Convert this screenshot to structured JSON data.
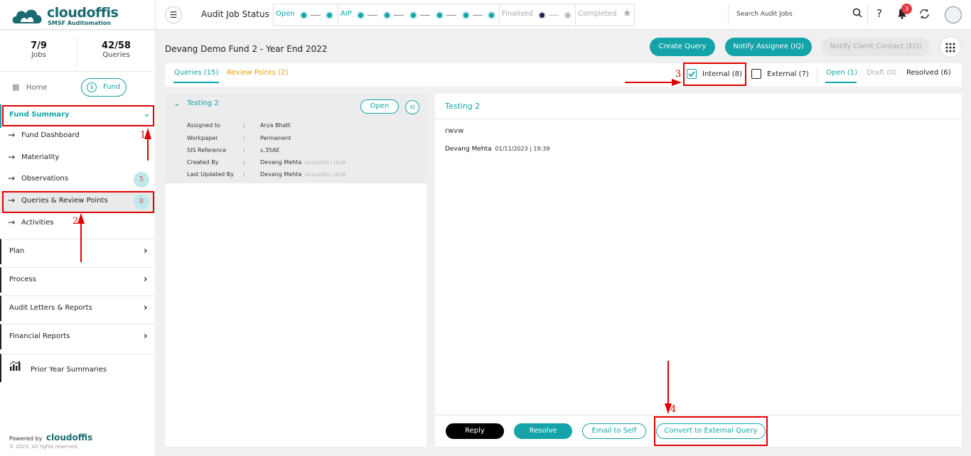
{
  "header": {
    "brand": "cloudoffis",
    "tagline": "SMSF Auditomation",
    "status_title": "Audit Job Status",
    "stages": [
      {
        "label": "Open",
        "dots": 2,
        "state": "active"
      },
      {
        "label": "AIP",
        "dots": 6,
        "state": "active"
      },
      {
        "label": "Finalised",
        "dots": 2,
        "state": "inactive"
      },
      {
        "label": "Completed",
        "dots": 0,
        "state": "inactive"
      }
    ],
    "search_placeholder": "Search Audit Jobs",
    "notification_count": "3",
    "help_label": "?"
  },
  "sidebar": {
    "stats": [
      {
        "value": "7/9",
        "label": "Jobs"
      },
      {
        "value": "42/58",
        "label": "Queries"
      }
    ],
    "home_label": "Home",
    "fund_label": "Fund",
    "fund_summary_label": "Fund Summary",
    "items": [
      {
        "label": "Fund Dashboard",
        "count": ""
      },
      {
        "label": "Materiality",
        "count": ""
      },
      {
        "label": "Observations",
        "count": "5"
      },
      {
        "label": "Queries & Review Points",
        "count": "8"
      },
      {
        "label": "Activities",
        "count": ""
      }
    ],
    "sections": [
      {
        "label": "Plan"
      },
      {
        "label": "Process"
      },
      {
        "label": "Audit Letters & Reports"
      },
      {
        "label": "Financial Reports"
      }
    ],
    "prior_year_label": "Prior Year Summaries",
    "powered_by": "Powered by",
    "footer_brand": "cloudoffis",
    "copyright": "© 2023. All rights reserved."
  },
  "main": {
    "title": "Devang Demo Fund 2 - Year End 2022",
    "actions": {
      "create_query": "Create Query",
      "notify_assignee": "Notify Assignee (IQ)",
      "notify_client": "Notify Client Contact (EQ)"
    },
    "tabs": {
      "queries": "Queries (15)",
      "review_points": "Review Points (2)"
    },
    "filters": {
      "internal": "Internal (8)",
      "external": "External (7)",
      "open": "Open (1)",
      "draft": "Draft (0)",
      "resolved": "Resolved (6)"
    },
    "query_card": {
      "title": "Testing 2",
      "status": "Open",
      "type": "IQ",
      "fields": [
        {
          "label": "Assigned to",
          "value": "Arya Bhatt",
          "ts": ""
        },
        {
          "label": "Workpaper",
          "value": "Permanent",
          "ts": ""
        },
        {
          "label": "SIS Reference",
          "value": "s.35AE",
          "ts": ""
        },
        {
          "label": "Created By",
          "value": "Devang Mehta",
          "ts": "01/11/2023 | 19:39"
        },
        {
          "label": "Last Updated By",
          "value": "Devang Mehta",
          "ts": "01/11/2023 | 19:39"
        }
      ]
    },
    "detail": {
      "title": "Testing 2",
      "message": "rwvw",
      "author": "Devang Mehta",
      "timestamp": "01/11/2023 | 19:39",
      "buttons": {
        "reply": "Reply",
        "resolve": "Resolve",
        "email": "Email to Self",
        "convert": "Convert to External Query"
      }
    }
  },
  "annotations": [
    "1",
    "2",
    "3",
    "4"
  ],
  "colors": {
    "accent": "#13a3a8",
    "annotation": "#e00000",
    "review": "#e6a100"
  }
}
